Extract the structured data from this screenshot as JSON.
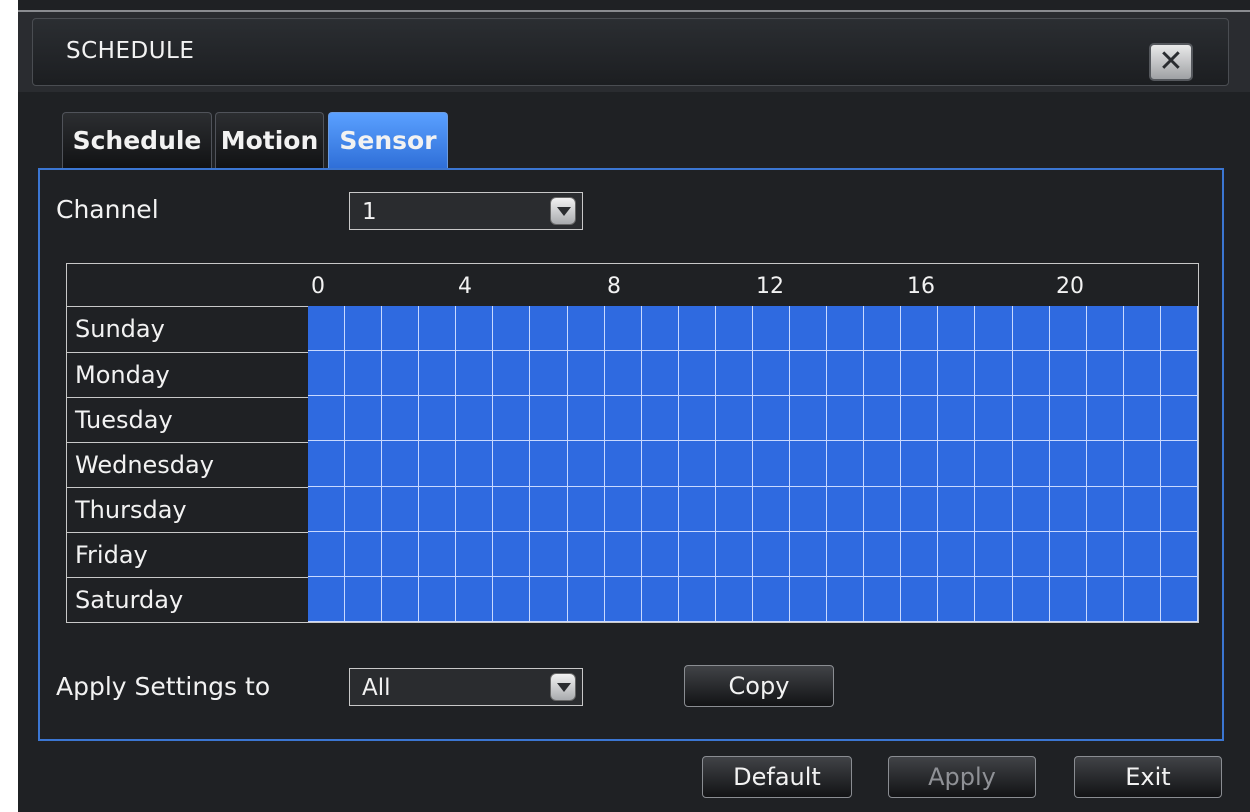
{
  "window": {
    "title": "SCHEDULE"
  },
  "tabs": [
    {
      "label": "Schedule",
      "active": false
    },
    {
      "label": "Motion",
      "active": false
    },
    {
      "label": "Sensor",
      "active": true
    }
  ],
  "channel": {
    "label": "Channel",
    "value": "1"
  },
  "grid": {
    "hour_labels": [
      "0",
      "4",
      "8",
      "12",
      "16",
      "20"
    ],
    "days": [
      "Sunday",
      "Monday",
      "Tuesday",
      "Wednesday",
      "Thursday",
      "Friday",
      "Saturday"
    ],
    "hours_per_day": 24,
    "all_slots_selected": true
  },
  "apply_settings": {
    "label": "Apply  Settings  to",
    "value": "All"
  },
  "buttons": {
    "copy": "Copy",
    "default": "Default",
    "apply": "Apply",
    "exit": "Exit"
  },
  "colors": {
    "active_tab": "#3b7de8",
    "selected_slot": "#2f6ae0",
    "panel_border": "#3b76d2",
    "background": "#1f2124"
  }
}
